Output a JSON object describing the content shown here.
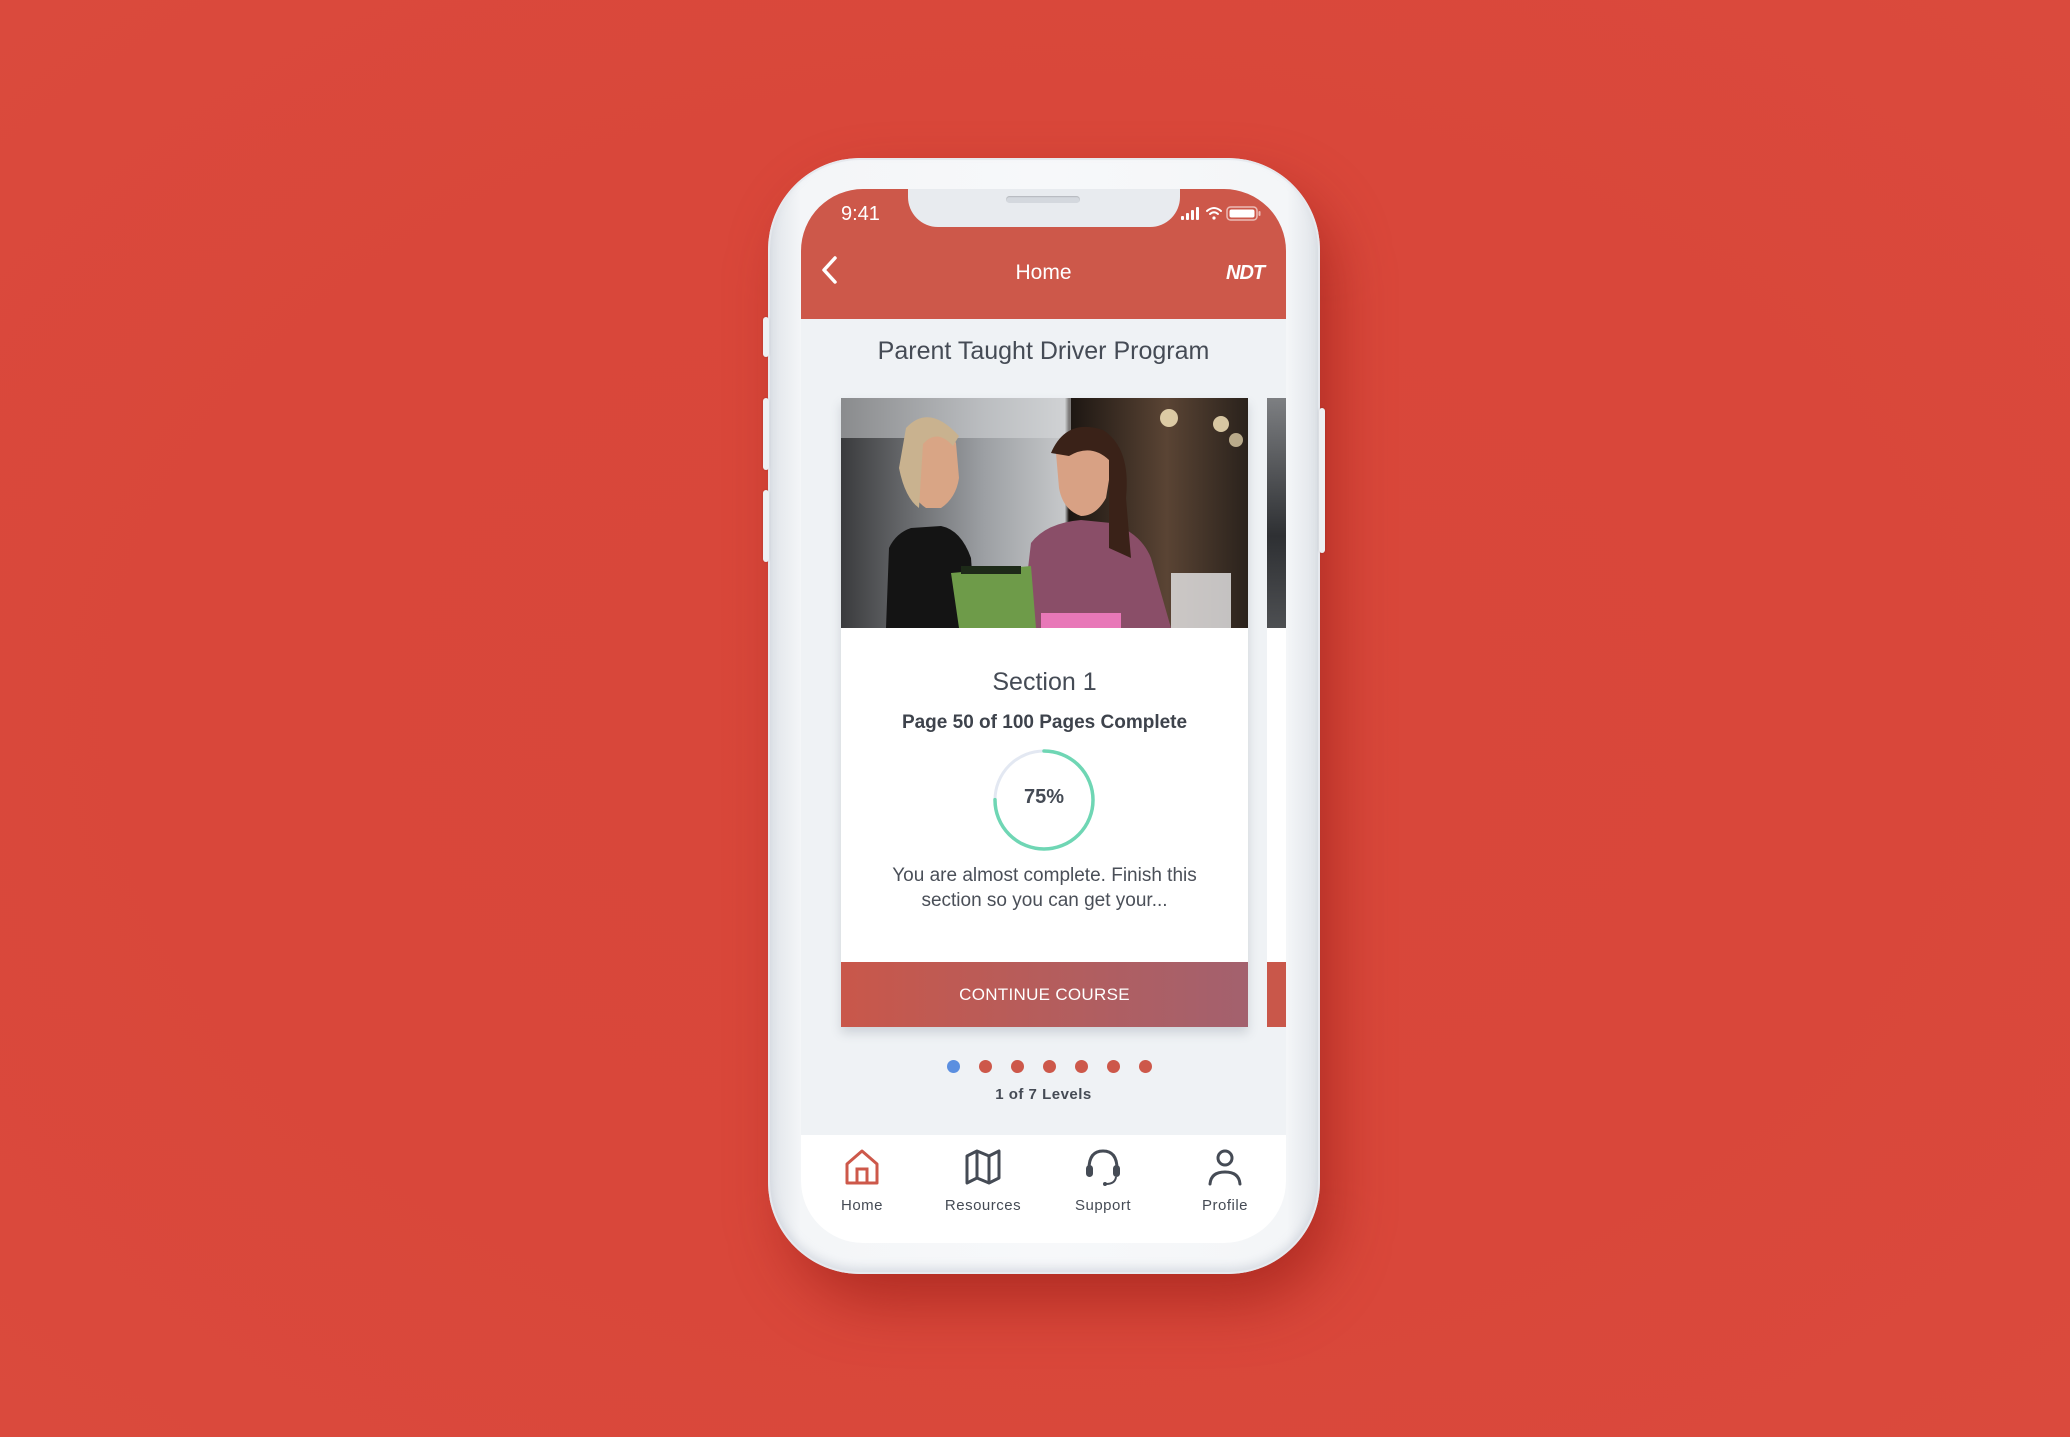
{
  "status_bar": {
    "time": "9:41"
  },
  "header": {
    "title": "Home",
    "logo": "NDT",
    "back_icon": "chevron-left-icon"
  },
  "program": {
    "title": "Parent Taught Driver Program"
  },
  "card": {
    "image_alt": "Two women smiling looking at a green clipboard in a gym",
    "section_title": "Section 1",
    "pages_status": "Page 50 of 100 Pages Complete",
    "progress_percent": 75,
    "progress_label": "75%",
    "description": "You are almost complete. Finish this section so you can get your...",
    "cta_label": "CONTINUE COURSE"
  },
  "pagination": {
    "total": 7,
    "current": 1,
    "label": "1 of 7 Levels",
    "active_color": "#5b8fe0",
    "inactive_color": "#cd584a"
  },
  "tabbar": {
    "items": [
      {
        "label": "Home",
        "icon": "home-icon",
        "active": true
      },
      {
        "label": "Resources",
        "icon": "map-icon",
        "active": false
      },
      {
        "label": "Support",
        "icon": "headset-icon",
        "active": false
      },
      {
        "label": "Profile",
        "icon": "user-icon",
        "active": false
      }
    ]
  },
  "colors": {
    "background": "#d9473a",
    "header": "#cd584a",
    "progress_ring": "#6fd6b4",
    "progress_track": "#e3e8f2",
    "text_dark": "#454b55"
  }
}
